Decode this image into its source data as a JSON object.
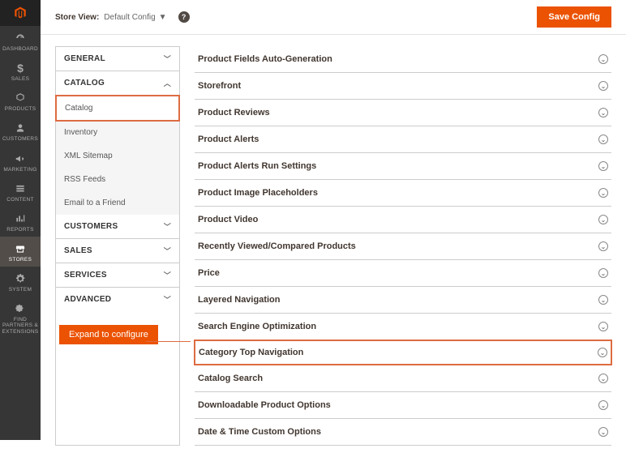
{
  "adminNav": [
    {
      "name": "dashboard",
      "label": "DASHBOARD",
      "icon": "gauge"
    },
    {
      "name": "sales",
      "label": "SALES",
      "icon": "dollar"
    },
    {
      "name": "products",
      "label": "PRODUCTS",
      "icon": "cube"
    },
    {
      "name": "customers",
      "label": "CUSTOMERS",
      "icon": "person"
    },
    {
      "name": "marketing",
      "label": "MARKETING",
      "icon": "megaphone"
    },
    {
      "name": "content",
      "label": "CONTENT",
      "icon": "stack"
    },
    {
      "name": "reports",
      "label": "REPORTS",
      "icon": "bars"
    },
    {
      "name": "stores",
      "label": "STORES",
      "icon": "store",
      "active": true
    },
    {
      "name": "system",
      "label": "SYSTEM",
      "icon": "gear"
    },
    {
      "name": "partners",
      "label": "FIND PARTNERS & EXTENSIONS",
      "icon": "puzzle"
    }
  ],
  "topbar": {
    "storeViewLabel": "Store View:",
    "storeViewValue": "Default Config",
    "saveLabel": "Save Config"
  },
  "configNav": {
    "groups": [
      {
        "label": "GENERAL",
        "expanded": false
      },
      {
        "label": "CATALOG",
        "expanded": true,
        "items": [
          {
            "label": "Catalog",
            "selected": true
          },
          {
            "label": "Inventory"
          },
          {
            "label": "XML Sitemap"
          },
          {
            "label": "RSS Feeds"
          },
          {
            "label": "Email to a Friend"
          }
        ]
      },
      {
        "label": "CUSTOMERS",
        "expanded": false
      },
      {
        "label": "SALES",
        "expanded": false
      },
      {
        "label": "SERVICES",
        "expanded": false
      },
      {
        "label": "ADVANCED",
        "expanded": false
      }
    ]
  },
  "sections": [
    {
      "title": "Product Fields Auto-Generation"
    },
    {
      "title": "Storefront"
    },
    {
      "title": "Product Reviews"
    },
    {
      "title": "Product Alerts"
    },
    {
      "title": "Product Alerts Run Settings"
    },
    {
      "title": "Product Image Placeholders"
    },
    {
      "title": "Product Video"
    },
    {
      "title": "Recently Viewed/Compared Products"
    },
    {
      "title": "Price"
    },
    {
      "title": "Layered Navigation"
    },
    {
      "title": "Search Engine Optimization"
    },
    {
      "title": "Category Top Navigation",
      "highlighted": true
    },
    {
      "title": "Catalog Search"
    },
    {
      "title": "Downloadable Product Options"
    },
    {
      "title": "Date & Time Custom Options"
    }
  ],
  "annotation": "Expand to configure"
}
